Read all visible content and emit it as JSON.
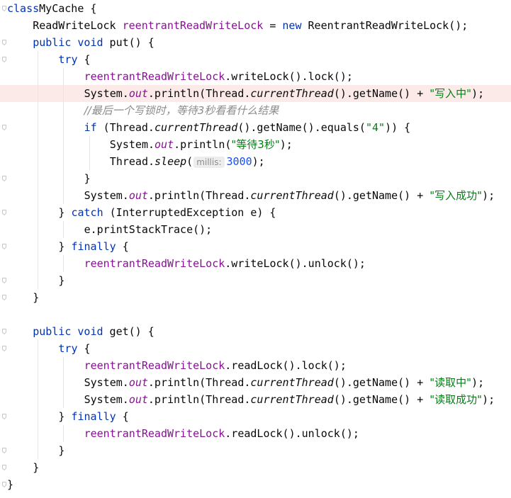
{
  "editor": {
    "language": "Java",
    "highlighted_line": 6,
    "colors": {
      "keyword": "#0033b3",
      "field": "#871094",
      "string": "#067d17",
      "number": "#1750eb",
      "comment": "#8c8c8c",
      "line_highlight": "#fbeae8"
    },
    "lines": [
      {
        "n": 1,
        "indent": 0,
        "fold": true,
        "tokens": [
          [
            "kw",
            "class"
          ],
          [
            "",
            "MyCache {"
          ]
        ]
      },
      {
        "n": 2,
        "indent": 1,
        "tokens": [
          [
            "",
            "ReadWriteLock "
          ],
          [
            "fld",
            "reentrantReadWriteLock"
          ],
          [
            "",
            " = "
          ],
          [
            "kw",
            "new"
          ],
          [
            "",
            " ReentrantReadWriteLock();"
          ]
        ]
      },
      {
        "n": 3,
        "indent": 1,
        "fold": true,
        "tokens": [
          [
            "kw",
            "public"
          ],
          [
            "",
            " "
          ],
          [
            "kw",
            "void"
          ],
          [
            "",
            " put() {"
          ]
        ]
      },
      {
        "n": 4,
        "indent": 2,
        "fold": true,
        "tokens": [
          [
            "kw",
            "try"
          ],
          [
            "",
            " {"
          ]
        ]
      },
      {
        "n": 5,
        "indent": 3,
        "tokens": [
          [
            "fld",
            "reentrantReadWriteLock"
          ],
          [
            "",
            ".writeLock().lock();"
          ]
        ]
      },
      {
        "n": 6,
        "indent": 3,
        "tokens": [
          [
            "",
            "System."
          ],
          [
            "st",
            "out"
          ],
          [
            "",
            ".println(Thread."
          ],
          [
            "stm",
            "currentThread"
          ],
          [
            "",
            "().getName() + "
          ],
          [
            "str",
            "\"写入中\""
          ],
          [
            "",
            ");"
          ]
        ]
      },
      {
        "n": 7,
        "indent": 3,
        "tokens": [
          [
            "cmt",
            "//最后一个写锁时，等待3秒看看什么结果"
          ]
        ]
      },
      {
        "n": 8,
        "indent": 3,
        "fold": true,
        "tokens": [
          [
            "kw",
            "if"
          ],
          [
            "",
            " (Thread."
          ],
          [
            "stm",
            "currentThread"
          ],
          [
            "",
            "().getName().equals("
          ],
          [
            "str",
            "\"4\""
          ],
          [
            "",
            ")) {"
          ]
        ]
      },
      {
        "n": 9,
        "indent": 4,
        "tokens": [
          [
            "",
            "System."
          ],
          [
            "st",
            "out"
          ],
          [
            "",
            ".println("
          ],
          [
            "str",
            "\"等待3秒\""
          ],
          [
            "",
            ");"
          ]
        ]
      },
      {
        "n": 10,
        "indent": 4,
        "tokens": [
          [
            "",
            "Thread."
          ],
          [
            "stm",
            "sleep"
          ],
          [
            "",
            "("
          ],
          [
            "hint",
            "millis:"
          ],
          [
            "num",
            "3000"
          ],
          [
            "",
            ");"
          ]
        ]
      },
      {
        "n": 11,
        "indent": 3,
        "fold": true,
        "tokens": [
          [
            "",
            "}"
          ]
        ]
      },
      {
        "n": 12,
        "indent": 3,
        "tokens": [
          [
            "",
            "System."
          ],
          [
            "st",
            "out"
          ],
          [
            "",
            ".println(Thread."
          ],
          [
            "stm",
            "currentThread"
          ],
          [
            "",
            "().getName() + "
          ],
          [
            "str",
            "\"写入成功\""
          ],
          [
            "",
            ");"
          ]
        ]
      },
      {
        "n": 13,
        "indent": 2,
        "fold": true,
        "tokens": [
          [
            "",
            "} "
          ],
          [
            "kw",
            "catch"
          ],
          [
            "",
            " (InterruptedException e) {"
          ]
        ]
      },
      {
        "n": 14,
        "indent": 3,
        "tokens": [
          [
            "",
            "e.printStackTrace();"
          ]
        ]
      },
      {
        "n": 15,
        "indent": 2,
        "fold": true,
        "tokens": [
          [
            "",
            "} "
          ],
          [
            "kw",
            "finally"
          ],
          [
            "",
            " {"
          ]
        ]
      },
      {
        "n": 16,
        "indent": 3,
        "tokens": [
          [
            "fld",
            "reentrantReadWriteLock"
          ],
          [
            "",
            ".writeLock().unlock();"
          ]
        ]
      },
      {
        "n": 17,
        "indent": 2,
        "fold": true,
        "tokens": [
          [
            "",
            "}"
          ]
        ]
      },
      {
        "n": 18,
        "indent": 1,
        "fold": true,
        "tokens": [
          [
            "",
            "}"
          ]
        ]
      },
      {
        "n": 19,
        "indent": 0,
        "tokens": []
      },
      {
        "n": 20,
        "indent": 1,
        "fold": true,
        "tokens": [
          [
            "kw",
            "public"
          ],
          [
            "",
            " "
          ],
          [
            "kw",
            "void"
          ],
          [
            "",
            " get() {"
          ]
        ]
      },
      {
        "n": 21,
        "indent": 2,
        "fold": true,
        "tokens": [
          [
            "kw",
            "try"
          ],
          [
            "",
            " {"
          ]
        ]
      },
      {
        "n": 22,
        "indent": 3,
        "tokens": [
          [
            "fld",
            "reentrantReadWriteLock"
          ],
          [
            "",
            ".readLock().lock();"
          ]
        ]
      },
      {
        "n": 23,
        "indent": 3,
        "tokens": [
          [
            "",
            "System."
          ],
          [
            "st",
            "out"
          ],
          [
            "",
            ".println(Thread."
          ],
          [
            "stm",
            "currentThread"
          ],
          [
            "",
            "().getName() + "
          ],
          [
            "str",
            "\"读取中\""
          ],
          [
            "",
            ");"
          ]
        ]
      },
      {
        "n": 24,
        "indent": 3,
        "tokens": [
          [
            "",
            "System."
          ],
          [
            "st",
            "out"
          ],
          [
            "",
            ".println(Thread."
          ],
          [
            "stm",
            "currentThread"
          ],
          [
            "",
            "().getName() + "
          ],
          [
            "str",
            "\"读取成功\""
          ],
          [
            "",
            ");"
          ]
        ]
      },
      {
        "n": 25,
        "indent": 2,
        "fold": true,
        "tokens": [
          [
            "",
            "} "
          ],
          [
            "kw",
            "finally"
          ],
          [
            "",
            " {"
          ]
        ]
      },
      {
        "n": 26,
        "indent": 3,
        "tokens": [
          [
            "fld",
            "reentrantReadWriteLock"
          ],
          [
            "",
            ".readLock().unlock();"
          ]
        ]
      },
      {
        "n": 27,
        "indent": 2,
        "fold": true,
        "tokens": [
          [
            "",
            "}"
          ]
        ]
      },
      {
        "n": 28,
        "indent": 1,
        "fold": true,
        "tokens": [
          [
            "",
            "}"
          ]
        ]
      },
      {
        "n": 29,
        "indent": 0,
        "fold": true,
        "tokens": [
          [
            "",
            "}"
          ]
        ]
      }
    ]
  }
}
